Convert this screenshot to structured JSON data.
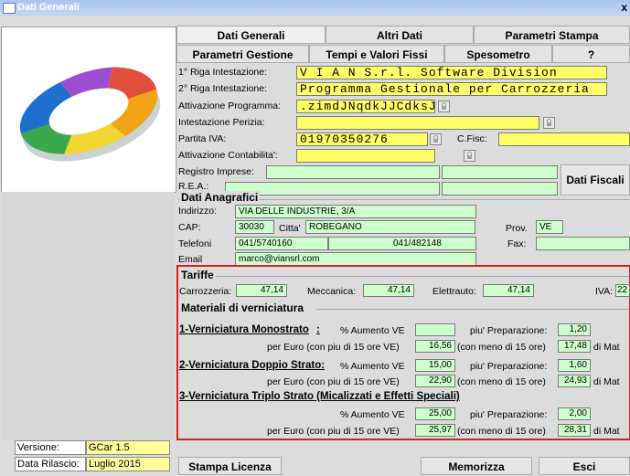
{
  "window": {
    "title": "Dati Generali",
    "close": "x"
  },
  "tabs_row1": [
    "Dati Generali",
    "Altri Dati",
    "Parametri Stampa"
  ],
  "tabs_row2": [
    "Parametri Gestione",
    "Tempi e Valori Fissi",
    "Spesometro",
    "?"
  ],
  "form": {
    "riga1_label": "1° Riga Intestazione:",
    "riga1_value": "V I A N  S.r.l.  Software Division",
    "riga2_label": "2° Riga Intestazione:",
    "riga2_value": "Programma Gestionale per Carrozzeria",
    "attivazione_label": "Attivazione Programma:",
    "attivazione_value": ".zimdJNqdkJJCdksJv.d",
    "perizia_label": "Intestazione Perizia:",
    "perizia_value": "",
    "piva_label": "Partita IVA:",
    "piva_value": "01970350276",
    "cfisc_label": "C.Fisc:",
    "cfisc_value": "",
    "contab_label": "Attivazione Contabilita':",
    "contab_value": "",
    "registro_label": "Registro Imprese:",
    "rea_label": "R.E.A.:",
    "dati_fiscali_button": "Dati Fiscali"
  },
  "anagrafici": {
    "title": "Dati Anagrafici",
    "indirizzo_label": "Indirizzo:",
    "indirizzo_value": "VIA DELLE INDUSTRIE, 3/A",
    "cap_label": "CAP:",
    "cap_value": "30030",
    "citta_label": "Citta'",
    "citta_value": "ROBEGANO",
    "prov_label": "Prov.",
    "prov_value": "VE",
    "telefoni_label": "Telefoni",
    "tel1": "041/5740160",
    "tel2": "041/482148",
    "fax_label": "Fax:",
    "fax_value": "",
    "email_label": "Email",
    "email_value": "marco@viansrl.com"
  },
  "tariffe": {
    "title": "Tariffe",
    "carrozzeria_label": "Carrozzeria:",
    "carrozzeria_value": "47,14",
    "meccanica_label": "Meccanica:",
    "meccanica_value": "47,14",
    "elettrauto_label": "Elettrauto:",
    "elettrauto_value": "47,14",
    "iva_label": "IVA:",
    "iva_value": "22"
  },
  "materiali": {
    "title": "Materiali di verniciatura",
    "mono_title": "1-Verniciatura Monostrato",
    "mono_colon": ":",
    "doppio_title": "2-Verniciatura Doppio Strato:",
    "triplo_title": "3-Verniciatura Triplo Strato (Micalizzati e Effetti Speciali)",
    "aumento_label": "% Aumento VE",
    "preparazione_label": "piu' Preparazione:",
    "per_euro_label": "per Euro (con piu di 15 ore VE)",
    "con_meno_label": "(con meno di 15 ore)",
    "di_mat_label": "di Mat",
    "mono_aumento": "",
    "mono_prep": "1,20",
    "mono_piu15": "16,56",
    "mono_meno15": "17,48",
    "doppio_aumento": "15,00",
    "doppio_prep": "1,60",
    "doppio_piu15": "22,90",
    "doppio_meno15": "24,93",
    "triplo_aumento": "25,00",
    "triplo_prep": "2,00",
    "triplo_piu15": "25,97",
    "triplo_meno15": "28,31"
  },
  "version": {
    "versione_label": "Versione:",
    "versione_value": "GCar 1.5",
    "rilascio_label": "Data Rilascio:",
    "rilascio_value": "Luglio 2015"
  },
  "buttons": {
    "stampa_licenza": "Stampa Licenza",
    "memorizza": "Memorizza",
    "esci": "Esci"
  },
  "colors": {
    "accent_red": "#d42020",
    "field_yellow": "#ffff66",
    "field_green": "#ccffcc"
  }
}
